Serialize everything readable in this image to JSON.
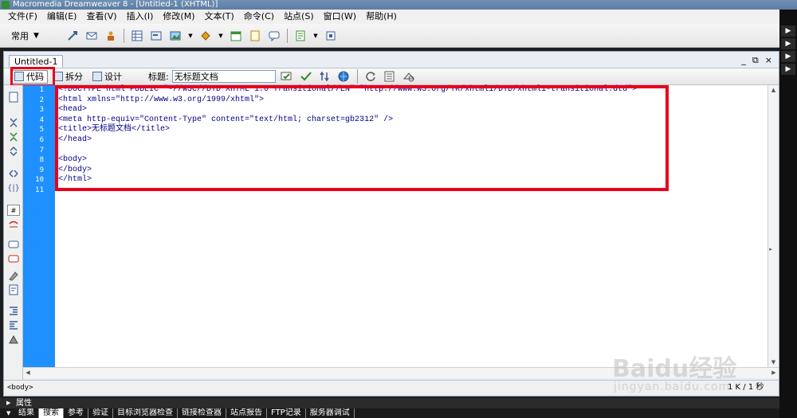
{
  "window": {
    "title": "Macromedia Dreamweaver 8 - [Untitled-1 (XHTML)]"
  },
  "menubar": {
    "items": [
      "文件(F)",
      "编辑(E)",
      "查看(V)",
      "插入(I)",
      "修改(M)",
      "文本(T)",
      "命令(C)",
      "站点(S)",
      "窗口(W)",
      "帮助(H)"
    ]
  },
  "insertbar": {
    "category": "常用"
  },
  "document": {
    "tab_label": "Untitled-1",
    "window_controls": [
      "_",
      "⧉",
      "×"
    ],
    "toolbar": {
      "code_label": "代码",
      "split_label": "拆分",
      "design_label": "设计",
      "title_label": "标题:",
      "title_value": "无标题文档"
    },
    "line_numbers": [
      "1",
      "2",
      "3",
      "4",
      "5",
      "6",
      "7",
      "8",
      "9",
      "10",
      "11"
    ],
    "code_lines": [
      "<!DOCTYPE html PUBLIC \"-//W3C//DTD XHTML 1.0 Transitional//EN\" \"http://www.w3.org/TR/xhtml1/DTD/xhtml1-transitional.dtd\">",
      "<html xmlns=\"http://www.w3.org/1999/xhtml\">",
      "<head>",
      "<meta http-equiv=\"Content-Type\" content=\"text/html; charset=gb2312\" />",
      "<title>无标题文档</title>",
      "</head>",
      "",
      "<body>",
      "</body>",
      "</html>",
      ""
    ],
    "status": {
      "tag_selector": "<body>",
      "size": "1 K / 1 秒"
    }
  },
  "panels": {
    "properties_label": "属性",
    "results_tabs": [
      "结果",
      "搜索",
      "参考",
      "验证",
      "目标浏览器检查",
      "链接检查器",
      "站点报告",
      "FTP记录",
      "服务器调试"
    ],
    "results_active_index": 1
  },
  "watermark": {
    "logo": "Baidu经验",
    "url": "jingyan.baidu.com"
  },
  "colors": {
    "gutter": "#1e90ff",
    "highlight": "#e8001c",
    "code_text": "#000088"
  }
}
